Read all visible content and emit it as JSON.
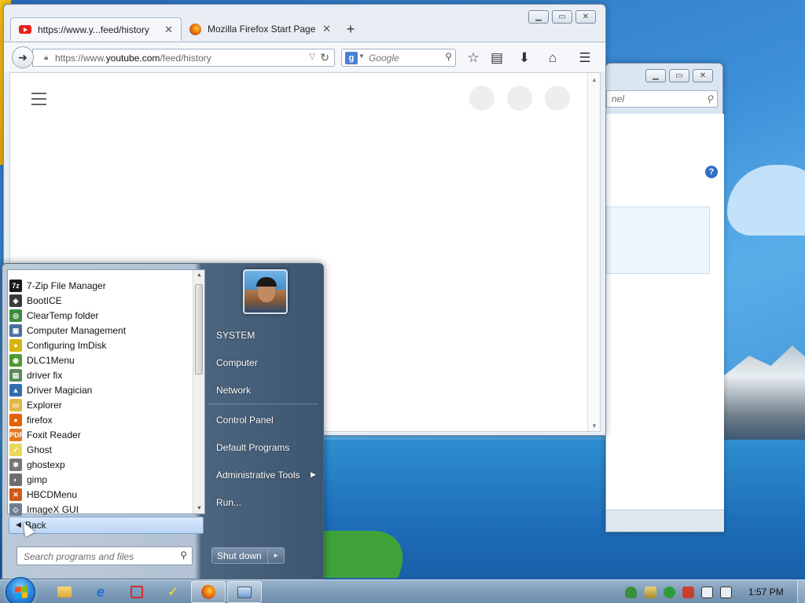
{
  "browser": {
    "tabs": [
      {
        "label": "https://www.y...feed/history",
        "active": true,
        "icon": "youtube-icon"
      },
      {
        "label": "Mozilla Firefox Start Page",
        "active": false,
        "icon": "firefox-icon"
      }
    ],
    "url_prefix": "https://www.",
    "url_host": "youtube.com",
    "url_path": "/feed/history",
    "search_engine_letter": "g",
    "search_placeholder": "Google"
  },
  "control_panel": {
    "search_placeholder": "nel",
    "help_glyph": "?"
  },
  "start_menu": {
    "programs": [
      {
        "label": "7-Zip File Manager",
        "icon": "7zip-icon",
        "color": "#1a1a1a",
        "glyph": "7z"
      },
      {
        "label": "BootICE",
        "icon": "bootice-icon",
        "color": "#3a3a3a",
        "glyph": "◈"
      },
      {
        "label": "ClearTemp  folder",
        "icon": "cleartemp-icon",
        "color": "#3c8d3c",
        "glyph": "◎"
      },
      {
        "label": "Computer Management",
        "icon": "computer-management-icon",
        "color": "#4a6fa5",
        "glyph": "▣"
      },
      {
        "label": "Configuring ImDisk",
        "icon": "imdisk-icon",
        "color": "#d8b410",
        "glyph": "●"
      },
      {
        "label": "DLC1Menu",
        "icon": "dlc-icon",
        "color": "#4d9a2e",
        "glyph": "◉"
      },
      {
        "label": "driver fix",
        "icon": "driver-fix-icon",
        "color": "#5a8a5a",
        "glyph": "▤"
      },
      {
        "label": "Driver Magician",
        "icon": "driver-magician-icon",
        "color": "#2e6db0",
        "glyph": "▲"
      },
      {
        "label": "Explorer",
        "icon": "explorer-icon",
        "color": "#e3b84a",
        "glyph": "▭"
      },
      {
        "label": "firefox",
        "icon": "firefox-icon",
        "color": "#e66000",
        "glyph": "●"
      },
      {
        "label": "Foxit Reader",
        "icon": "foxit-icon",
        "color": "#e07a1f",
        "glyph": "PDF"
      },
      {
        "label": "Ghost",
        "icon": "ghost-icon",
        "color": "#e8d85a",
        "glyph": "✓"
      },
      {
        "label": "ghostexp",
        "icon": "ghostexp-icon",
        "color": "#777777",
        "glyph": "✱"
      },
      {
        "label": "gimp",
        "icon": "gimp-icon",
        "color": "#6e6e6e",
        "glyph": "◐"
      },
      {
        "label": "HBCDMenu",
        "icon": "hbcd-icon",
        "color": "#d05a1a",
        "glyph": "✕"
      },
      {
        "label": "ImageX GUI",
        "icon": "imagex-icon",
        "color": "#6f7f90",
        "glyph": "◇"
      }
    ],
    "back_label": "Back",
    "search_placeholder": "Search programs and files",
    "right_items": [
      {
        "label": "SYSTEM",
        "submenu": false
      },
      {
        "label": "Computer",
        "submenu": false
      },
      {
        "label": "Network",
        "submenu": false
      },
      {
        "label": "Control Panel",
        "submenu": false
      },
      {
        "label": "Default Programs",
        "submenu": false
      },
      {
        "label": "Administrative Tools",
        "submenu": true
      },
      {
        "label": "Run...",
        "submenu": false
      }
    ],
    "shutdown_label": "Shut down"
  },
  "taskbar": {
    "pinned": [
      {
        "icon": "file-explorer-icon"
      },
      {
        "icon": "internet-explorer-icon"
      },
      {
        "icon": "hbcd-icon"
      },
      {
        "icon": "ghost-icon"
      },
      {
        "icon": "firefox-icon",
        "active": true
      },
      {
        "icon": "control-panel-icon",
        "active": true
      }
    ],
    "tray": [
      "security-icon",
      "network-icon",
      "media-icon",
      "hbcd-tray-icon",
      "display-icon",
      "volume-muted-icon"
    ],
    "clock": "1:57 PM"
  },
  "colors": {
    "taskbar": "#7f9cb8",
    "start_menu_right": "#3d566f",
    "youtube_red": "#e62117"
  }
}
